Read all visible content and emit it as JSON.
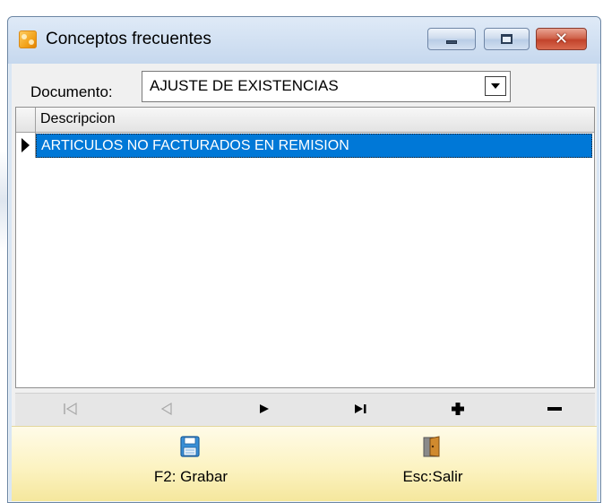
{
  "window": {
    "title": "Conceptos frecuentes",
    "controls": {
      "minimize_icon": "minimize-icon",
      "maximize_icon": "maximize-icon",
      "close_icon": "close-icon",
      "close_glyph": "✕"
    }
  },
  "document": {
    "label": "Documento:",
    "selected": "AJUSTE DE EXISTENCIAS"
  },
  "grid": {
    "columns": [
      "Descripcion"
    ],
    "rows": [
      {
        "descripcion": "ARTICULOS NO FACTURADOS EN REMISION",
        "selected": true
      }
    ]
  },
  "navigator": {
    "buttons": [
      {
        "name": "first",
        "icon": "first-record-icon",
        "enabled": false
      },
      {
        "name": "prior",
        "icon": "prior-record-icon",
        "enabled": false
      },
      {
        "name": "next",
        "icon": "next-record-icon",
        "enabled": true
      },
      {
        "name": "last",
        "icon": "last-record-icon",
        "enabled": true
      },
      {
        "name": "insert",
        "icon": "plus-icon",
        "enabled": true
      },
      {
        "name": "delete",
        "icon": "minus-icon",
        "enabled": true
      }
    ]
  },
  "footer": {
    "save_label": "F2: Grabar",
    "save_icon": "floppy-disk-icon",
    "exit_label": "Esc:Salir",
    "exit_icon": "door-exit-icon"
  },
  "colors": {
    "selection": "#0078d7",
    "footer_bg": "#fcf3c2",
    "window_frame": "#c6d8ee"
  }
}
